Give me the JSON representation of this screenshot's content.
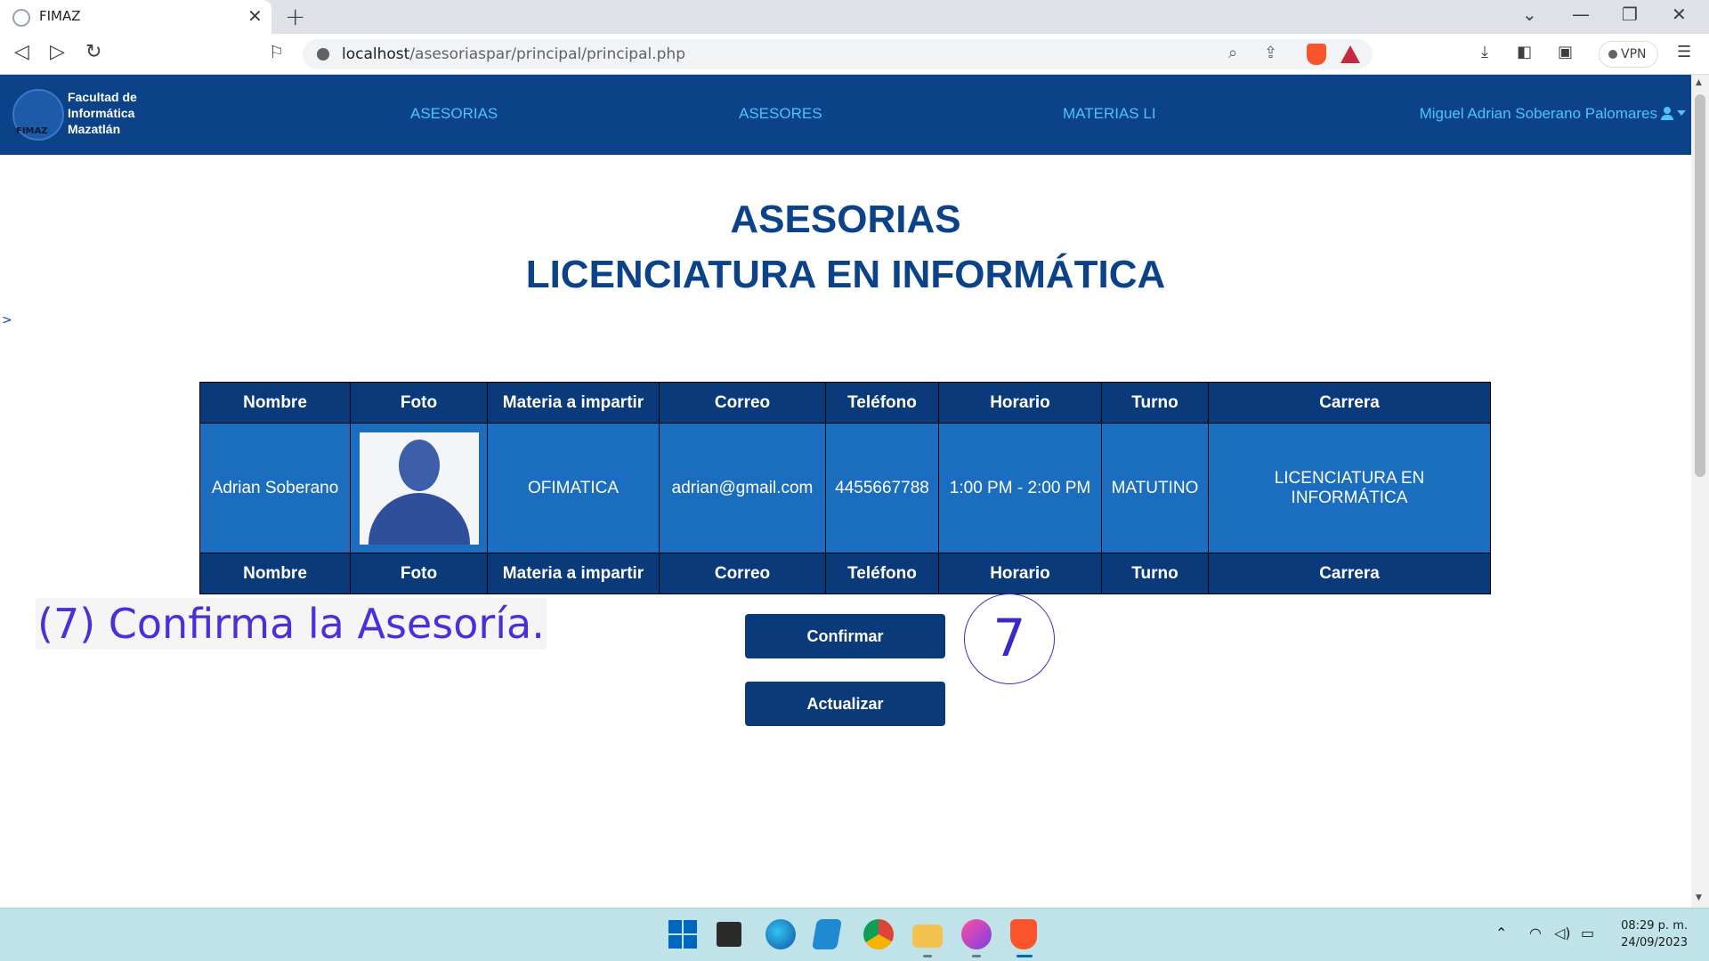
{
  "browser": {
    "tab_title": "FIMAZ",
    "tab_close": "✕",
    "new_tab": "+",
    "url_host": "localhost",
    "url_path": "/asesoriaspar/principal/principal.php",
    "vpn_label": "VPN"
  },
  "navbar": {
    "logo_lines": [
      "Facultad de",
      "Informática",
      "Mazatlán"
    ],
    "logo_mark": "FIMAZ",
    "links": [
      "ASESORIAS",
      "ASESORES",
      "MATERIAS LI"
    ],
    "user_name": "Miguel Adrian Soberano Palomares"
  },
  "page": {
    "title": "ASESORIAS",
    "subtitle": "LICENCIATURA EN INFORMÁTICA",
    "stray_text": ">"
  },
  "table": {
    "headers": [
      "Nombre",
      "Foto",
      "Materia a impartir",
      "Correo",
      "Teléfono",
      "Horario",
      "Turno",
      "Carrera"
    ],
    "row": {
      "nombre": "Adrian Soberano",
      "materia": "OFIMATICA",
      "correo": "adrian@gmail.com",
      "telefono": "4455667788",
      "horario": "1:00 PM - 2:00 PM",
      "turno": "MATUTINO",
      "carrera": "LICENCIATURA EN INFORMÁTICA"
    }
  },
  "actions": {
    "confirm_label": "Confirmar",
    "update_label": "Actualizar"
  },
  "annotation": {
    "text": "(7) Confirma la Asesoría.",
    "step": "7"
  },
  "taskbar": {
    "time": "08:29 p. m.",
    "date": "24/09/2023"
  },
  "colors": {
    "navbar": "#0b4288",
    "nav_link": "#4fc3f7",
    "table_header": "#0b3a7a",
    "table_cell": "#1a6dbf",
    "annotation": "#4b2fd8"
  }
}
